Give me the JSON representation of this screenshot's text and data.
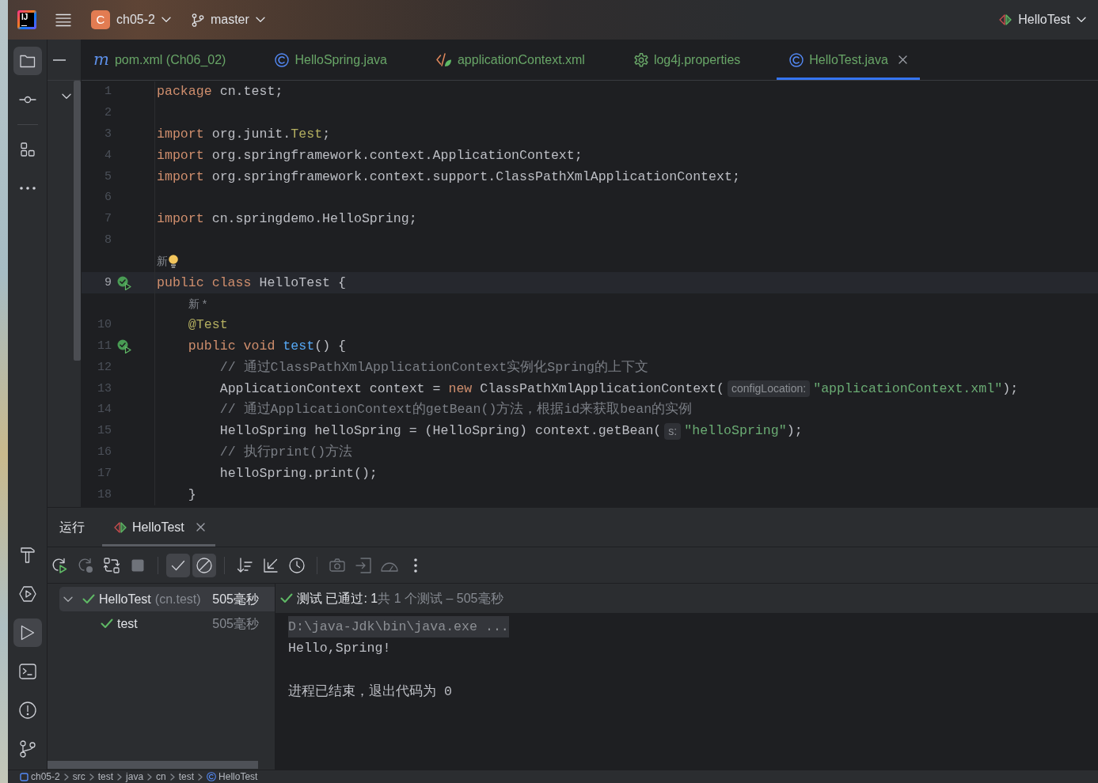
{
  "title_bar": {
    "logo": "IJ",
    "project": {
      "badge": "C",
      "name": "ch05-2"
    },
    "branch": "master",
    "run_config": "HelloTest"
  },
  "tool_strip": {
    "top": [
      {
        "items": [
          {
            "kind": "project",
            "selected": true
          },
          {
            "kind": "commit",
            "selected": false
          }
        ]
      },
      {
        "items": [
          {
            "kind": "structure",
            "selected": false
          },
          {
            "kind": "more",
            "selected": false
          }
        ]
      }
    ],
    "bottom": [
      {
        "items": [
          {
            "kind": "build",
            "selected": false
          },
          {
            "kind": "services",
            "selected": false
          },
          {
            "kind": "run",
            "selected": true
          },
          {
            "kind": "terminal",
            "selected": false
          },
          {
            "kind": "problems",
            "selected": false
          },
          {
            "kind": "git",
            "selected": false
          }
        ]
      }
    ]
  },
  "editor": {
    "tabs": [
      {
        "label": "pom.xml (Ch06_02)",
        "kind": "maven",
        "glyph": "m",
        "selected": false
      },
      {
        "label": "HelloSpring.java",
        "kind": "class",
        "selected": false
      },
      {
        "label": "applicationContext.xml",
        "kind": "xml",
        "selected": false
      },
      {
        "label": "log4j.properties",
        "kind": "properties",
        "selected": false
      },
      {
        "label": "HelloTest.java",
        "kind": "class",
        "selected": true
      }
    ],
    "lines": [
      {
        "kind": "code",
        "number": "1",
        "current": false,
        "tokens": [
          {
            "kind": "keyword",
            "text": "package"
          },
          {
            "kind": "plain",
            "text": " cn.test;"
          }
        ]
      },
      {
        "kind": "code",
        "number": "2",
        "current": false
      },
      {
        "kind": "code",
        "number": "3",
        "current": false,
        "tokens": [
          {
            "kind": "keyword",
            "text": "import"
          },
          {
            "kind": "plain",
            "text": " org.junit."
          },
          {
            "kind": "class",
            "text": "Test"
          },
          {
            "kind": "plain",
            "text": ";"
          }
        ]
      },
      {
        "kind": "code",
        "number": "4",
        "current": false,
        "tokens": [
          {
            "kind": "keyword",
            "text": "import"
          },
          {
            "kind": "plain",
            "text": " org.springframework.context.ApplicationContext;"
          }
        ]
      },
      {
        "kind": "code",
        "number": "5",
        "current": false,
        "tokens": [
          {
            "kind": "keyword",
            "text": "import"
          },
          {
            "kind": "plain",
            "text": " org.springframework.context.support.ClassPathXmlApplicationContext;"
          }
        ]
      },
      {
        "kind": "code",
        "number": "6",
        "current": false
      },
      {
        "kind": "code",
        "number": "7",
        "current": false,
        "tokens": [
          {
            "kind": "keyword",
            "text": "import"
          },
          {
            "kind": "plain",
            "text": " cn.springdemo.HelloSpring;"
          }
        ]
      },
      {
        "kind": "code",
        "number": "8",
        "current": false
      },
      {
        "kind": "author",
        "text": "新",
        "bulb": true
      },
      {
        "kind": "test_entry",
        "number": "9",
        "current": true,
        "tokens": [
          {
            "kind": "keyword",
            "text": "public class"
          },
          {
            "kind": "plain",
            "text": " HelloTest {"
          }
        ]
      },
      {
        "kind": "author",
        "text": "    新 *",
        "bulb": false
      },
      {
        "kind": "code",
        "number": "10",
        "current": false,
        "tokens": [
          {
            "kind": "annotation",
            "text": "    @Test"
          }
        ]
      },
      {
        "kind": "test_entry",
        "number": "11",
        "current": false,
        "tokens": [
          {
            "kind": "keyword",
            "text": "    public void "
          },
          {
            "kind": "method",
            "text": "test"
          },
          {
            "kind": "plain",
            "text": "() {"
          }
        ]
      },
      {
        "kind": "code",
        "number": "12",
        "current": false,
        "tokens": [
          {
            "kind": "comment",
            "text": "        // 通过ClassPathXmlApplicationContext实例化Spring的上下文"
          }
        ]
      },
      {
        "kind": "code",
        "number": "13",
        "current": false,
        "tokens": [
          {
            "kind": "plain",
            "text": "        ApplicationContext context = "
          },
          {
            "kind": "keyword",
            "text": "new"
          },
          {
            "kind": "plain",
            "text": " ClassPathXmlApplicationContext("
          },
          {
            "kind": "hint",
            "text": "configLocation:"
          },
          {
            "kind": "string",
            "text": "\"applicationContext.xml\""
          },
          {
            "kind": "plain",
            "text": ");"
          }
        ]
      },
      {
        "kind": "code",
        "number": "14",
        "current": false,
        "tokens": [
          {
            "kind": "comment",
            "text": "        // 通过ApplicationContext的getBean()方法，根据id来获取bean的实例"
          }
        ]
      },
      {
        "kind": "code",
        "number": "15",
        "current": false,
        "tokens": [
          {
            "kind": "plain",
            "text": "        HelloSpring helloSpring = (HelloSpring) context.getBean("
          },
          {
            "kind": "hint",
            "text": "s:"
          },
          {
            "kind": "string",
            "text": "\"helloSpring\""
          },
          {
            "kind": "plain",
            "text": ");"
          }
        ]
      },
      {
        "kind": "code",
        "number": "16",
        "current": false,
        "tokens": [
          {
            "kind": "comment",
            "text": "        // 执行print()方法"
          }
        ]
      },
      {
        "kind": "code",
        "number": "17",
        "current": false,
        "tokens": [
          {
            "kind": "plain",
            "text": "        helloSpring.print();"
          }
        ]
      },
      {
        "kind": "code",
        "number": "18",
        "current": false,
        "tokens": [
          {
            "kind": "plain",
            "text": "    }"
          }
        ]
      }
    ]
  },
  "run_panel": {
    "title": "运行",
    "tabs": [
      {
        "label": "HelloTest",
        "selected": true
      }
    ],
    "toolbar": [
      {
        "items": [
          {
            "kind": "rerun",
            "disabled": false,
            "on": false
          },
          {
            "kind": "rerun-failed",
            "disabled": true,
            "on": false
          },
          {
            "kind": "auto-rerun",
            "disabled": false,
            "on": false
          },
          {
            "kind": "stop",
            "disabled": true,
            "on": false
          }
        ]
      },
      {
        "items": [
          {
            "kind": "show-passed",
            "disabled": false,
            "on": true
          },
          {
            "kind": "show-ignored",
            "disabled": false,
            "on": true
          }
        ]
      },
      {
        "items": [
          {
            "kind": "sort",
            "disabled": false,
            "on": false
          },
          {
            "kind": "collapse",
            "disabled": false,
            "on": false
          },
          {
            "kind": "history",
            "disabled": false,
            "on": false
          }
        ]
      },
      {
        "items": [
          {
            "kind": "snapshot",
            "disabled": true,
            "on": false
          },
          {
            "kind": "import",
            "disabled": true,
            "on": false
          },
          {
            "kind": "coverage",
            "disabled": true,
            "on": false
          },
          {
            "kind": "more",
            "disabled": false,
            "on": false
          }
        ]
      }
    ],
    "tree": [
      {
        "label": "HelloTest",
        "package": "(cn.test)",
        "time": "505毫秒",
        "passed": true,
        "expanded": true,
        "selected": true,
        "children": [
          {
            "label": "test",
            "time": "505毫秒",
            "passed": true,
            "selected": false
          }
        ]
      }
    ],
    "summary": {
      "passed": true,
      "text": "测试 已通过: 1",
      "detail": "共 1 个测试 – 505毫秒"
    },
    "console": [
      {
        "kind": "command",
        "text": "D:\\java-Jdk\\bin\\java.exe ..."
      },
      {
        "kind": "output",
        "text": "Hello,Spring!"
      },
      {
        "kind": "exit",
        "text": "进程已结束，退出代码为 0"
      }
    ]
  },
  "breadcrumbs": [
    {
      "kind": "module",
      "label": "ch05-2"
    },
    {
      "kind": "folder",
      "label": "src"
    },
    {
      "kind": "folder",
      "label": "test"
    },
    {
      "kind": "folder",
      "label": "java"
    },
    {
      "kind": "folder",
      "label": "cn"
    },
    {
      "kind": "folder",
      "label": "test"
    },
    {
      "kind": "class",
      "label": "HelloTest"
    }
  ]
}
